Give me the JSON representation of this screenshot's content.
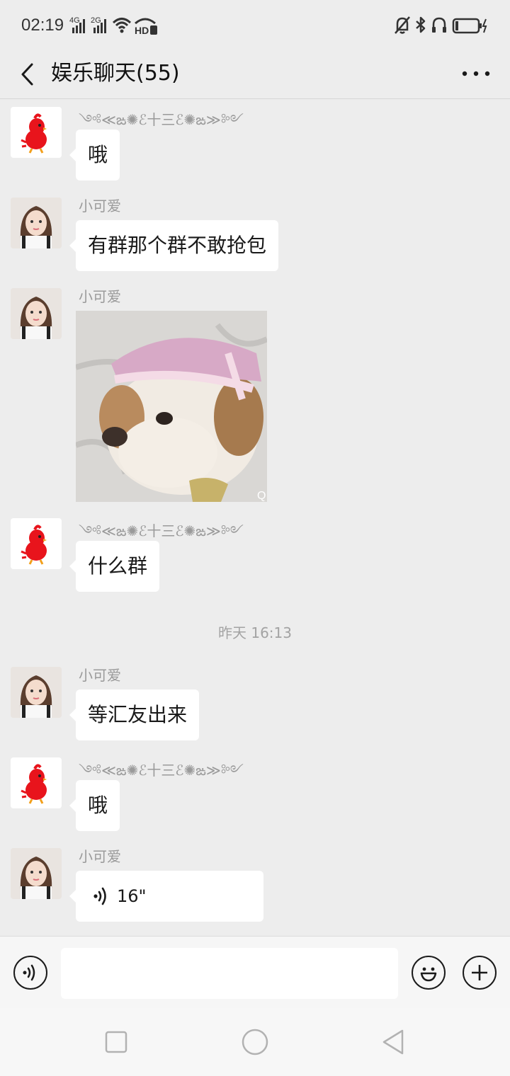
{
  "status_bar": {
    "time": "02:19",
    "signal_1": "4G",
    "signal_2": "2G",
    "hd": "HD"
  },
  "header": {
    "title": "娱乐聊天(55)",
    "back_icon": "chevron-left-icon",
    "more_icon": "more-horizontal-icon"
  },
  "messages": [
    {
      "sender": "༺≪ఙ✺ℰ十三ℰ✺ఙ≫༻",
      "avatar": "red-bird-avatar",
      "text": "哦"
    },
    {
      "sender": "小可爱",
      "avatar": "girl-avatar",
      "text": "有群那个群不敢抢包"
    },
    {
      "sender": "小可爱",
      "avatar": "girl-avatar",
      "image": "dog-with-mask-photo",
      "image_corner": "Q"
    },
    {
      "sender": "༺≪ఙ✺ℰ十三ℰ✺ఙ≫༻",
      "avatar": "red-bird-avatar",
      "text": "什么群"
    },
    {
      "sender": "小可爱",
      "avatar": "girl-avatar",
      "text": "等汇友出来"
    },
    {
      "sender": "༺≪ఙ✺ℰ十三ℰ✺ఙ≫༻",
      "avatar": "red-bird-avatar",
      "text": "哦"
    },
    {
      "sender": "小可爱",
      "avatar": "girl-avatar",
      "voice_duration": "16\""
    }
  ],
  "timestamp": "昨天 16:13",
  "input_bar": {
    "voice_icon": "voice-toggle-icon",
    "emoji_icon": "emoji-icon",
    "plus_icon": "plus-icon",
    "input_value": ""
  },
  "system_nav": [
    "recent-apps-icon",
    "home-icon",
    "back-icon"
  ],
  "colors": {
    "background": "#ededed",
    "bubble": "#ffffff",
    "sender_name": "#9a9a9a",
    "input_bar": "#f6f6f6"
  }
}
